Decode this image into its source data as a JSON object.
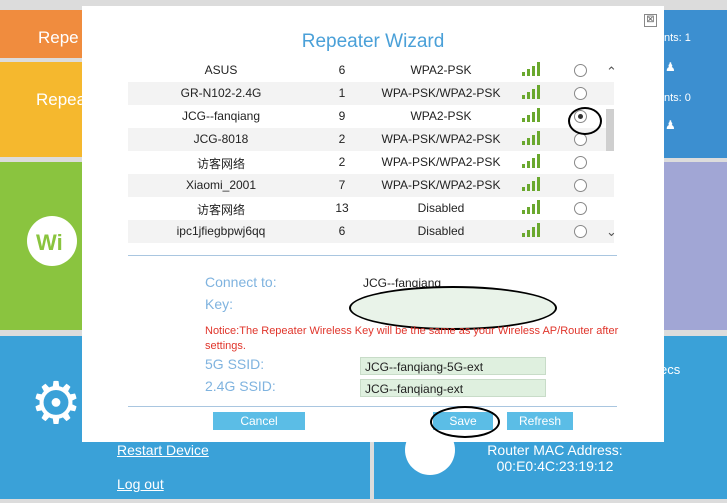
{
  "background": {
    "tile_orange_label": "Repe",
    "tile_yellow_label": "Repea",
    "tile_right1_clients_a": "nts: 1",
    "tile_right1_clients_b": "nts: 0",
    "tile_right2_label": "ecs",
    "restart_link": "Restart Device",
    "logout_link": "Log out",
    "router_mac_label": "Router MAC Address:",
    "router_mac_value": "00:E0:4C:23:19:12"
  },
  "modal": {
    "title": "Repeater Wizard",
    "close_label": "⊠"
  },
  "networks": [
    {
      "ssid": "ASUS",
      "channel": "6",
      "security": "WPA2-PSK",
      "signal": 4,
      "selected": false
    },
    {
      "ssid": "GR-N102-2.4G",
      "channel": "1",
      "security": "WPA-PSK/WPA2-PSK",
      "signal": 4,
      "selected": false
    },
    {
      "ssid": "JCG--fanqiang",
      "channel": "9",
      "security": "WPA2-PSK",
      "signal": 4,
      "selected": true
    },
    {
      "ssid": "JCG-8018",
      "channel": "2",
      "security": "WPA-PSK/WPA2-PSK",
      "signal": 4,
      "selected": false
    },
    {
      "ssid": "访客网络",
      "channel": "2",
      "security": "WPA-PSK/WPA2-PSK",
      "signal": 4,
      "selected": false
    },
    {
      "ssid": "Xiaomi_2001",
      "channel": "7",
      "security": "WPA-PSK/WPA2-PSK",
      "signal": 4,
      "selected": false
    },
    {
      "ssid": "访客网络",
      "channel": "13",
      "security": "Disabled",
      "signal": 4,
      "selected": false
    },
    {
      "ssid": "ipc1jfiegbpwj6qq",
      "channel": "6",
      "security": "Disabled",
      "signal": 4,
      "selected": false
    }
  ],
  "form": {
    "connect_to_label": "Connect to:",
    "connect_to_value": "JCG--fanqiang",
    "key_label": "Key:",
    "key_value": "",
    "notice": "Notice:The Repeater Wireless Key will be the same as your Wireless AP/Router after settings.",
    "ssid5g_label": "5G SSID:",
    "ssid5g_value": "JCG--fanqiang-5G-ext",
    "ssid24g_label": "2.4G SSID:",
    "ssid24g_value": "JCG--fanqiang-ext"
  },
  "buttons": {
    "cancel": "Cancel",
    "save": "Save",
    "refresh": "Refresh"
  },
  "colors": {
    "accent": "#5bbde6",
    "title": "#4aa0d8",
    "notice": "#e0352b",
    "signal": "#6aa82e"
  }
}
